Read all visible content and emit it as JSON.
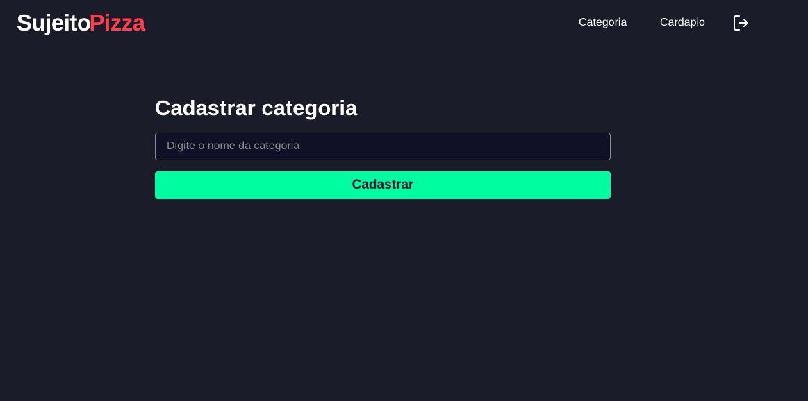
{
  "header": {
    "logo": {
      "part_1": "Sujeito",
      "part_2": "Pizza"
    },
    "nav": {
      "items": [
        {
          "label": "Categoria"
        },
        {
          "label": "Cardapio"
        }
      ],
      "logout_icon": "log-out-icon"
    }
  },
  "main": {
    "title": "Cadastrar categoria",
    "category_input": {
      "value": "",
      "placeholder": "Digite o nome da categoria"
    },
    "submit_label": "Cadastrar"
  },
  "colors": {
    "background": "#1b1c29",
    "input_background": "#101026",
    "brand_red": "#ff3f4b",
    "accent_green": "#00fda0",
    "text": "#ffffff",
    "placeholder": "#8a8a8a"
  }
}
